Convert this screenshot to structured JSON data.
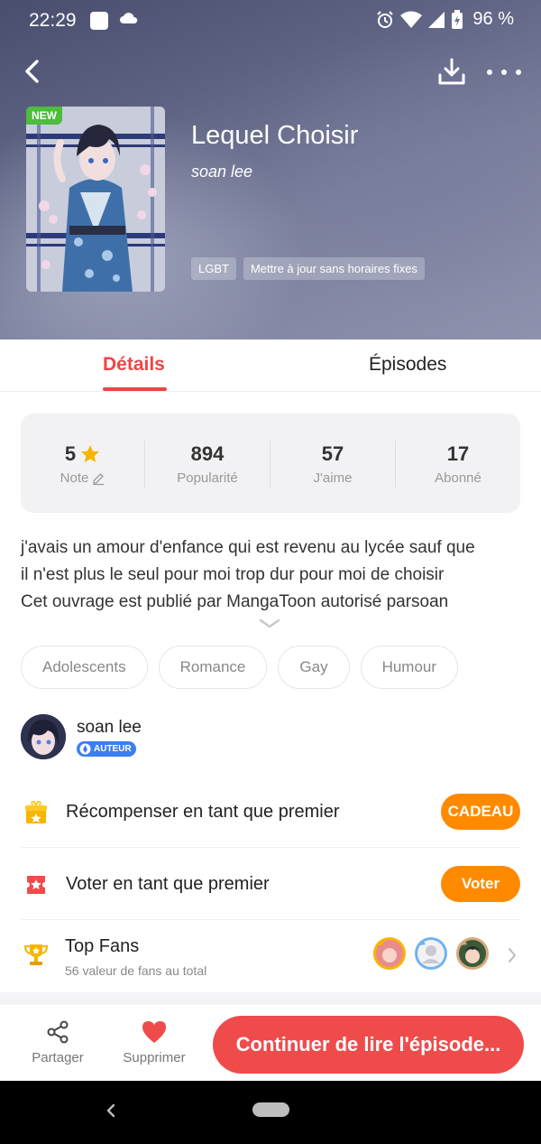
{
  "status_bar": {
    "time": "22:29",
    "battery": "96 %"
  },
  "header": {
    "back_icon": "back-arrow-icon",
    "download_icon": "download-icon",
    "more_icon": "more-dots-icon"
  },
  "book": {
    "badge": "NEW",
    "title": "Lequel Choisir",
    "author": "soan lee",
    "tags": [
      "LGBT",
      "Mettre à jour sans horaires fixes"
    ]
  },
  "tabs": [
    {
      "label": "Détails",
      "active": true
    },
    {
      "label": "Épisodes",
      "active": false
    }
  ],
  "stats": [
    {
      "value": "5",
      "label": "Note"
    },
    {
      "value": "894",
      "label": "Popularité"
    },
    {
      "value": "57",
      "label": "J'aime"
    },
    {
      "value": "17",
      "label": "Abonné"
    }
  ],
  "description": {
    "lines": [
      "j'avais un amour d'enfance qui est revenu au lycée sauf que",
      "il n'est plus le seul pour moi trop dur pour moi de choisir",
      "Cet ouvrage est publié par MangaToon  autorisé parsoan"
    ]
  },
  "genres": [
    "Adolescents",
    "Romance",
    "Gay",
    "Humour"
  ],
  "author_block": {
    "name": "soan lee",
    "badge": "AUTEUR"
  },
  "rows": {
    "reward": {
      "label": "Récompenser en tant que premier",
      "button": "CADEAU"
    },
    "vote": {
      "label": "Voter en tant que premier",
      "button": "Voter"
    },
    "fans": {
      "title": "Top Fans",
      "subtitle": "56 valeur de fans au total"
    }
  },
  "bottom": {
    "share": "Partager",
    "delete": "Supprimer",
    "continue": "Continuer de lire l'épisode..."
  },
  "colors": {
    "accent": "#ef4444",
    "orange": "#ff8a00",
    "star": "#f7b500",
    "author_badge": "#3b7ff0"
  }
}
